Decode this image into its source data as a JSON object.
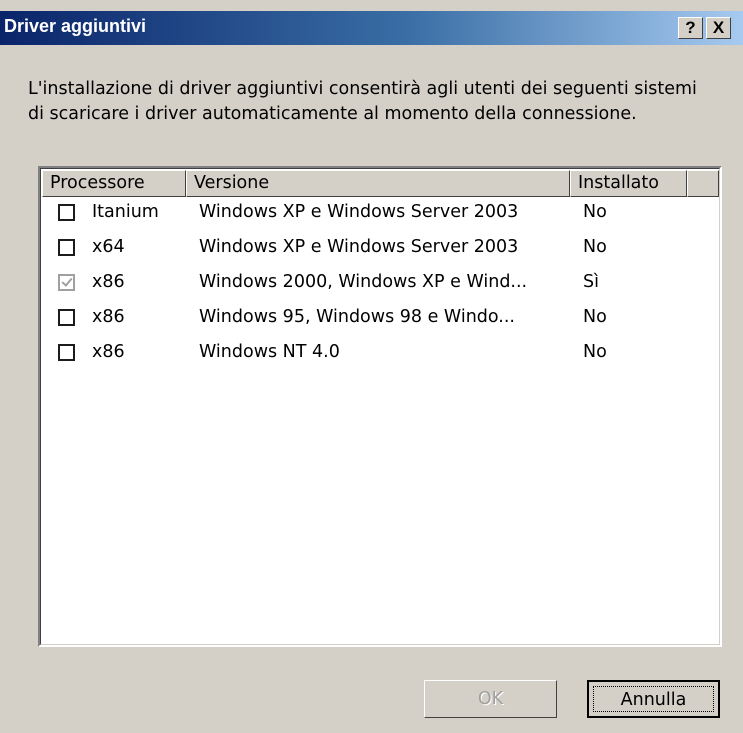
{
  "window": {
    "title": "Driver aggiuntivi",
    "help_label": "?",
    "close_label": "X"
  },
  "description": "L'installazione di driver aggiuntivi consentirà agli utenti dei seguenti sistemi di scaricare i driver automaticamente al momento della connessione.",
  "table": {
    "headers": {
      "processor": "Processore",
      "version": "Versione",
      "installed": "Installato"
    },
    "rows": [
      {
        "processor": "Itanium",
        "version": "Windows XP e Windows Server 2003",
        "installed": "No",
        "checked": false,
        "disabled": false
      },
      {
        "processor": "x64",
        "version": "Windows XP e Windows Server 2003",
        "installed": "No",
        "checked": false,
        "disabled": false
      },
      {
        "processor": "x86",
        "version": "Windows 2000, Windows XP e Wind...",
        "installed": "Sì",
        "checked": true,
        "disabled": true
      },
      {
        "processor": "x86",
        "version": "Windows 95, Windows 98 e Windo...",
        "installed": "No",
        "checked": false,
        "disabled": false
      },
      {
        "processor": "x86",
        "version": "Windows NT 4.0",
        "installed": "No",
        "checked": false,
        "disabled": false
      }
    ]
  },
  "buttons": {
    "ok_label": "OK",
    "cancel_label": "Annulla"
  }
}
